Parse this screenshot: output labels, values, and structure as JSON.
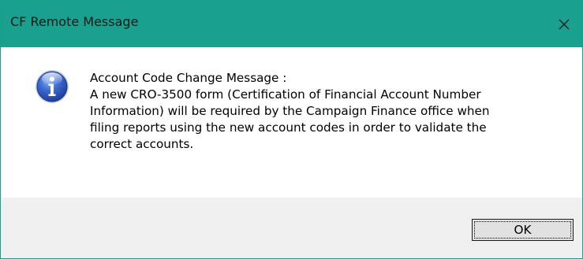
{
  "window": {
    "title": "CF Remote Message",
    "close_icon": "close-icon",
    "accent_color": "#1aa08f"
  },
  "message": {
    "icon": "info-icon",
    "lines": [
      "Account Code Change Message :",
      "A new CRO-3500 form (Certification of Financial Account Number",
      "Information) will be required by the Campaign Finance office when",
      "filing reports using the new account codes in order to validate the",
      "correct accounts."
    ]
  },
  "footer": {
    "ok_label": "OK"
  }
}
